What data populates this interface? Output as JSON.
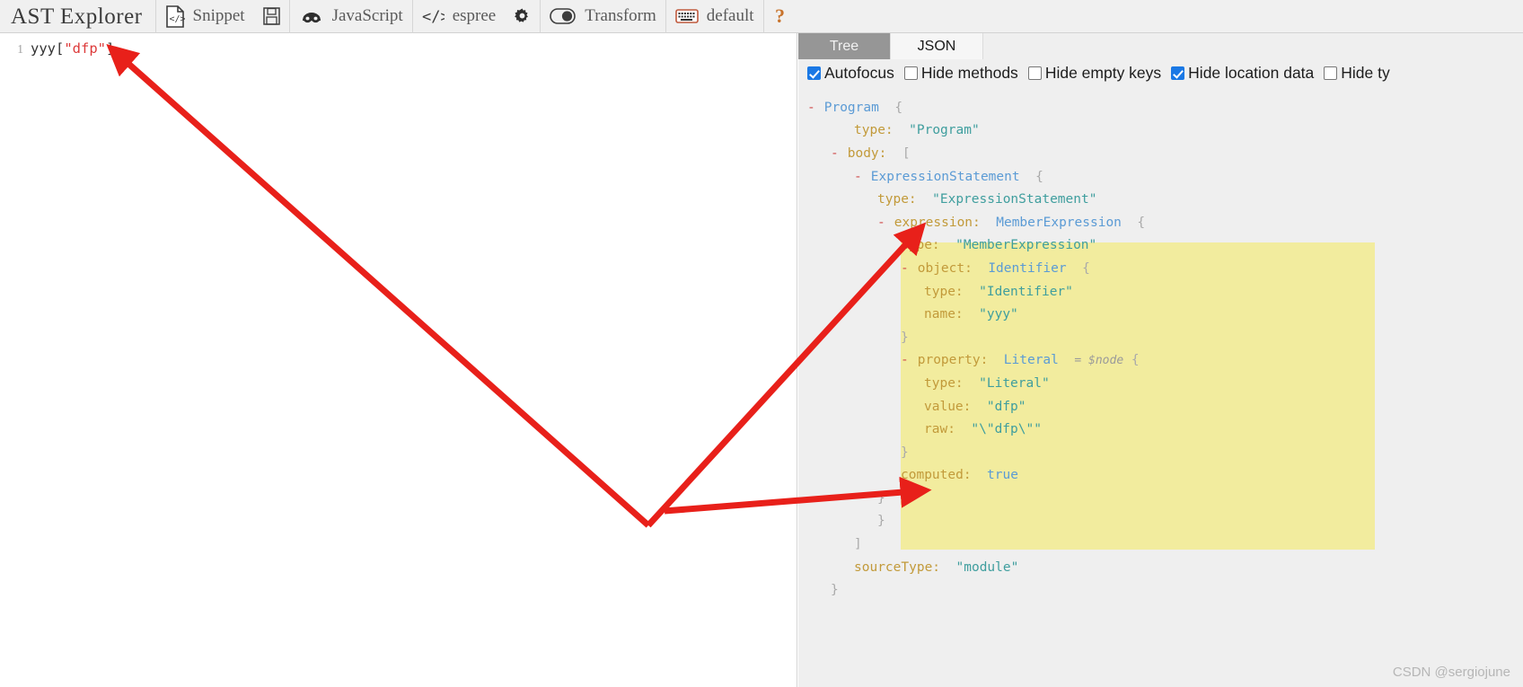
{
  "app": {
    "brand": "AST Explorer"
  },
  "toolbar": {
    "items": [
      {
        "icon": "code-file-icon",
        "label": "Snippet"
      },
      {
        "icon": "save-disk-icon",
        "label": ""
      },
      {
        "icon": "babel-infinity-icon",
        "label": "JavaScript"
      },
      {
        "icon": "code-brackets-icon",
        "label": "espree"
      },
      {
        "icon": "gear-icon",
        "label": ""
      },
      {
        "icon": "toggle-switch-icon",
        "label": "Transform"
      },
      {
        "icon": "keyboard-icon",
        "label": "default"
      },
      {
        "icon": "help-question-icon",
        "label": ""
      }
    ]
  },
  "editor": {
    "line_number": "1",
    "tokens": [
      {
        "text": "yyy",
        "kind": "id"
      },
      {
        "text": "[",
        "kind": "punc"
      },
      {
        "text": "\"dfp\"",
        "kind": "str"
      },
      {
        "text": "]",
        "kind": "punc"
      }
    ]
  },
  "panel": {
    "tabs": [
      {
        "label": "Tree",
        "active": true
      },
      {
        "label": "JSON",
        "active": false
      }
    ],
    "options": [
      {
        "label": "Autofocus",
        "checked": true
      },
      {
        "label": "Hide methods",
        "checked": false
      },
      {
        "label": "Hide empty keys",
        "checked": false
      },
      {
        "label": "Hide location data",
        "checked": true
      },
      {
        "label": "Hide ty",
        "checked": false
      }
    ]
  },
  "tree": {
    "rows": [
      {
        "indent": 0,
        "toggle": "-",
        "node": "Program",
        "brace": "{",
        "highlight": false
      },
      {
        "indent": 2,
        "key": "type:",
        "string": "\"Program\"",
        "highlight": false
      },
      {
        "indent": 1,
        "toggle": "-",
        "key": "body:",
        "brace": "[",
        "highlight": false
      },
      {
        "indent": 2,
        "toggle": "-",
        "node": "ExpressionStatement",
        "brace": "{",
        "highlight": false
      },
      {
        "indent": 3,
        "key": "type:",
        "string": "\"ExpressionStatement\"",
        "highlight": false
      },
      {
        "indent": 3,
        "toggle": "-",
        "key": "expression:",
        "node": "MemberExpression",
        "brace": "{",
        "highlight": true
      },
      {
        "indent": 4,
        "key": "type:",
        "string": "\"MemberExpression\"",
        "highlight": true
      },
      {
        "indent": 4,
        "toggle": "-",
        "key": "object:",
        "node": "Identifier",
        "brace": "{",
        "highlight": true
      },
      {
        "indent": 5,
        "key": "type:",
        "string": "\"Identifier\"",
        "highlight": true
      },
      {
        "indent": 5,
        "key": "name:",
        "string": "\"yyy\"",
        "highlight": true
      },
      {
        "indent": 4,
        "brace": "}",
        "highlight": true
      },
      {
        "indent": 4,
        "toggle": "-",
        "key": "property:",
        "node": "Literal",
        "annotation": "= $node",
        "brace": "{",
        "highlight": true
      },
      {
        "indent": 5,
        "key": "type:",
        "string": "\"Literal\"",
        "highlight": true
      },
      {
        "indent": 5,
        "key": "value:",
        "string": "\"dfp\"",
        "highlight": true
      },
      {
        "indent": 5,
        "key": "raw:",
        "string": "\"\\\"dfp\\\"\"",
        "highlight": true
      },
      {
        "indent": 4,
        "brace": "}",
        "highlight": true
      },
      {
        "indent": 4,
        "key": "computed:",
        "bool": "true",
        "highlight": true
      },
      {
        "indent": 3,
        "brace": "}",
        "highlight": true
      },
      {
        "indent": 3,
        "brace": "}",
        "highlight": false
      },
      {
        "indent": 2,
        "brace": "]",
        "highlight": false
      },
      {
        "indent": 2,
        "key": "sourceType:",
        "string": "\"module\"",
        "highlight": false
      },
      {
        "indent": 1,
        "brace": "}",
        "highlight": false
      }
    ]
  },
  "annotations": {
    "arrow_color": "#e8201a",
    "watermark": "CSDN @sergiojune"
  }
}
